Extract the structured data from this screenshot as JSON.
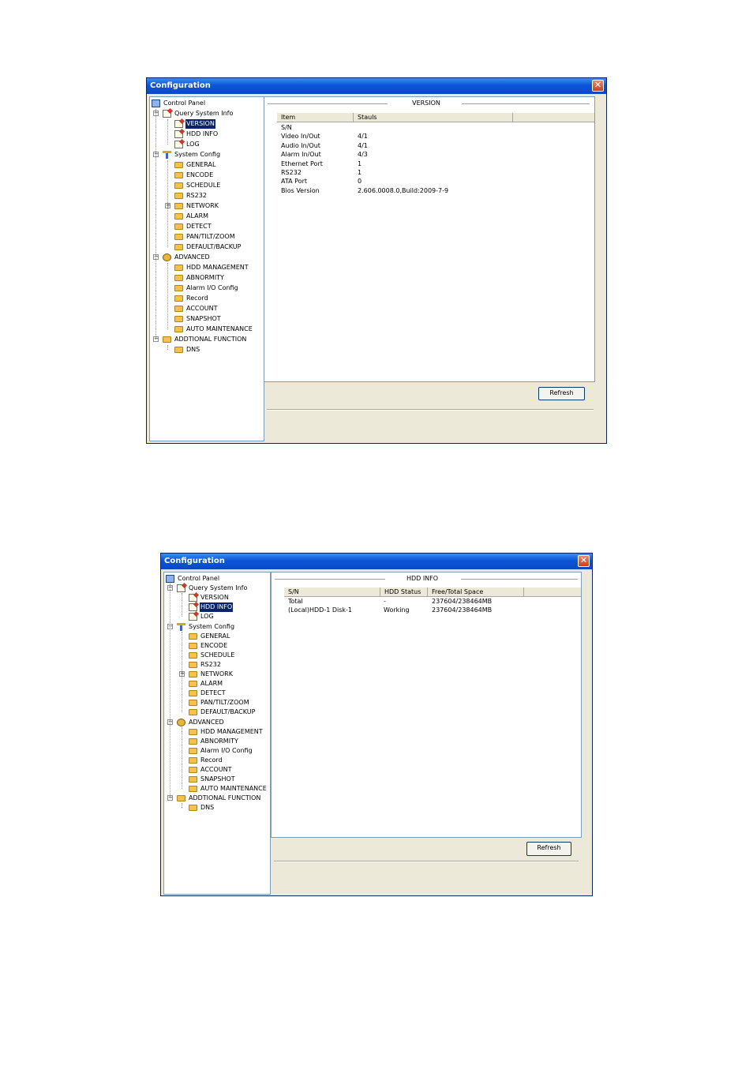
{
  "window_title": "Configuration",
  "close_glyph": "✕",
  "tree": {
    "root": "Control Panel",
    "query": "Query System Info",
    "version": "VERSION",
    "hdd_info": "HDD INFO",
    "log": "LOG",
    "system_config": "System Config",
    "general": "GENERAL",
    "encode": "ENCODE",
    "schedule": "SCHEDULE",
    "rs232": "RS232",
    "network": "NETWORK",
    "alarm": "ALARM",
    "detect": "DETECT",
    "ptz": "PAN/TILT/ZOOM",
    "default_backup": "DEFAULT/BACKUP",
    "advanced": "ADVANCED",
    "hdd_management": "HDD MANAGEMENT",
    "abnormity": "ABNORMITY",
    "alarm_io": "Alarm I/O Config",
    "record": "Record",
    "account": "ACCOUNT",
    "snapshot": "SNAPSHOT",
    "auto_maintenance": "AUTO MAINTENANCE",
    "additional": "ADDTIONAL FUNCTION",
    "dns": "DNS",
    "expander_plus": "+",
    "expander_minus": "−"
  },
  "version_panel": {
    "title": "VERSION",
    "col_item": "Item",
    "col_status": "Stauls",
    "rows": [
      {
        "item": "S/N",
        "status": ""
      },
      {
        "item": "Video In/Out",
        "status": "4/1"
      },
      {
        "item": "Audio In/Out",
        "status": "4/1"
      },
      {
        "item": "Alarm In/Out",
        "status": "4/3"
      },
      {
        "item": "Ethernet Port",
        "status": "1"
      },
      {
        "item": "RS232",
        "status": "1"
      },
      {
        "item": "ATA Port",
        "status": "0"
      },
      {
        "item": "Bios Version",
        "status": "2.606.0008.0,Build:2009-7-9"
      }
    ],
    "refresh": "Refresh"
  },
  "hdd_panel": {
    "title": "HDD INFO",
    "col_sn": "S/N",
    "col_status": "HDD Status",
    "col_space": "Free/Total Space",
    "rows": [
      {
        "sn": "Total",
        "status": "-",
        "space": "237604/238464MB"
      },
      {
        "sn": "(Local)HDD-1 Disk-1",
        "status": "Working",
        "space": "237604/238464MB"
      }
    ],
    "refresh": "Refresh"
  },
  "colors": {
    "title_blue": "#0b55d8",
    "selection": "#0a246a",
    "folder": "#f4c24a",
    "close_red": "#c6411e"
  }
}
